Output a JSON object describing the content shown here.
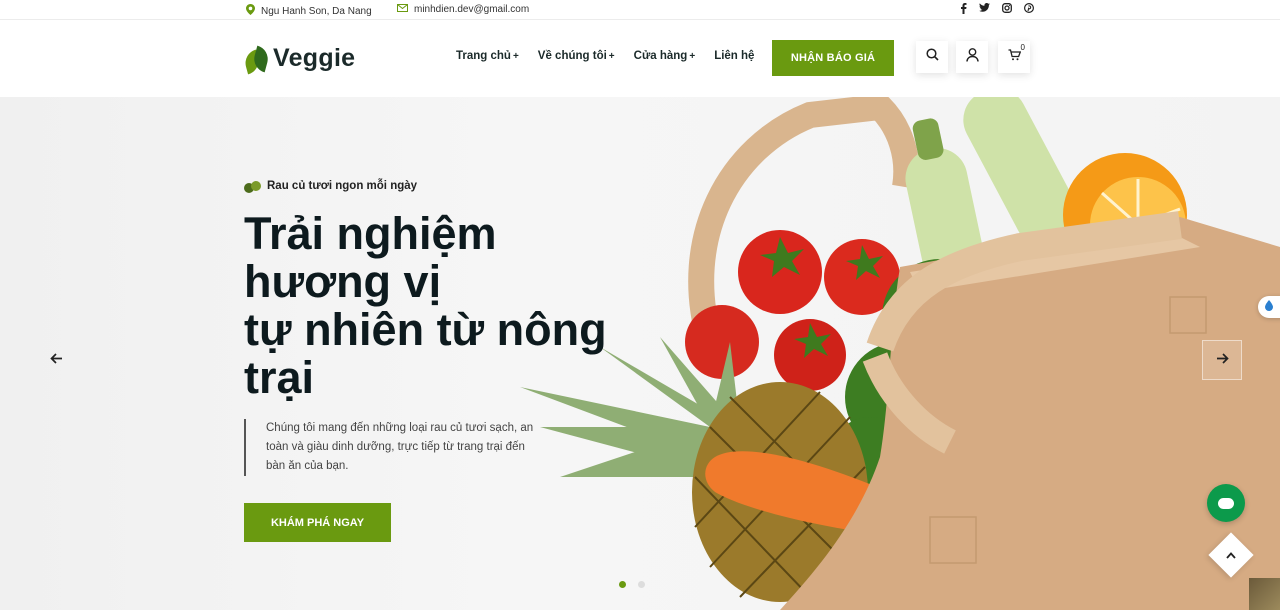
{
  "topbar": {
    "address": "Ngu Hanh Son, Da Nang",
    "email": "minhdien.dev@gmail.com",
    "socials": [
      "facebook-icon",
      "twitter-icon",
      "instagram-icon",
      "pinterest-icon"
    ]
  },
  "header": {
    "logo_text": "Veggie",
    "nav": [
      {
        "label": "Trang chủ",
        "has_submenu": true
      },
      {
        "label": "Về chúng tôi",
        "has_submenu": true
      },
      {
        "label": "Cửa hàng",
        "has_submenu": true
      },
      {
        "label": "Liên hệ",
        "has_submenu": false
      }
    ],
    "plus": "+",
    "quote_button": "NHẬN BÁO GIÁ",
    "cart_count": "0"
  },
  "hero": {
    "tagline": "Rau củ tươi ngon mỗi ngày",
    "headline_lines": [
      "Trải nghiệm",
      "hương vị",
      "tự nhiên từ nông",
      "trại"
    ],
    "description": "Chúng tôi mang đến những loại rau củ tươi sạch, an toàn và giàu dinh dưỡng, trực tiếp từ trang trại đến bàn ăn của bạn.",
    "cta": "KHÁM PHÁ NGAY",
    "slides_total": 2,
    "slide_active": 1
  },
  "colors": {
    "accent": "#6a9a10",
    "dark_text": "#0d1a1e",
    "chat_green": "#0c9a4b"
  }
}
